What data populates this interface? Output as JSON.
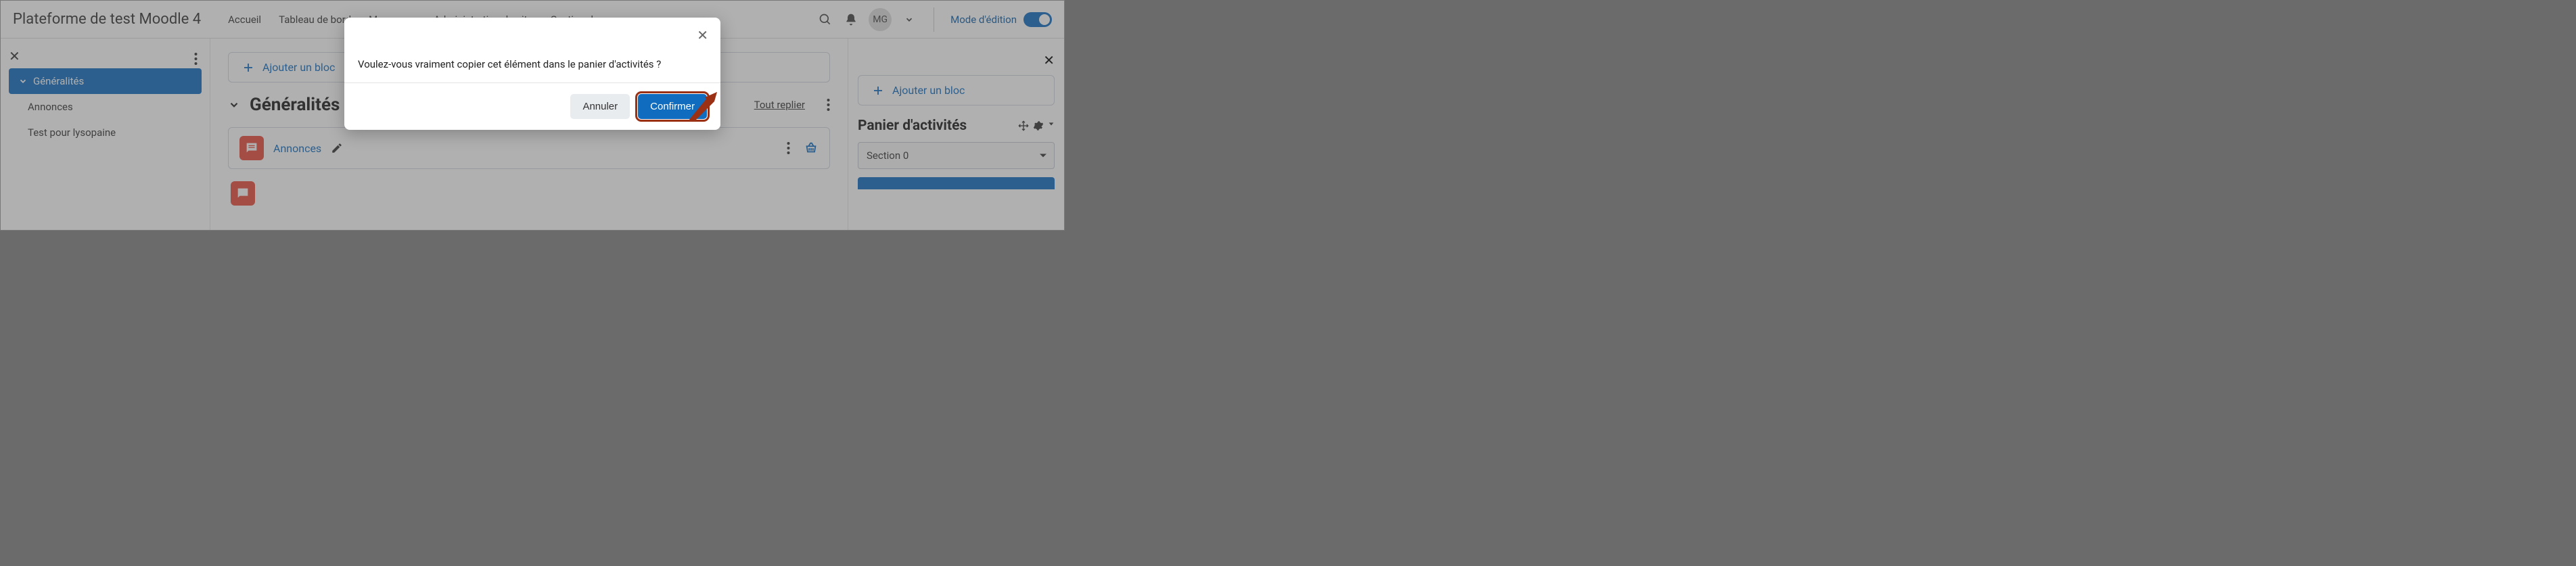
{
  "header": {
    "brand": "Plateforme de test Moodle 4",
    "nav": [
      "Accueil",
      "Tableau de bord",
      "Mes cours",
      "Administration du site",
      "Gestion des..."
    ],
    "user_initials": "MG",
    "edit_mode_label": "Mode d'édition"
  },
  "sidebar_left": {
    "section_label": "Généralités",
    "sub_items": [
      "Annonces",
      "Test pour lysopaine"
    ]
  },
  "main": {
    "add_block_label": "Ajouter un bloc",
    "section_title": "Généralités",
    "collapse_label": "Tout replier",
    "activity": {
      "name": "Annonces"
    }
  },
  "sidebar_right": {
    "add_block_label": "Ajouter un bloc",
    "basket_title": "Panier d'activités",
    "select_value": "Section 0"
  },
  "modal": {
    "message": "Voulez-vous vraiment copier cet élément dans le panier d'activités ?",
    "cancel": "Annuler",
    "confirm": "Confirmer"
  }
}
